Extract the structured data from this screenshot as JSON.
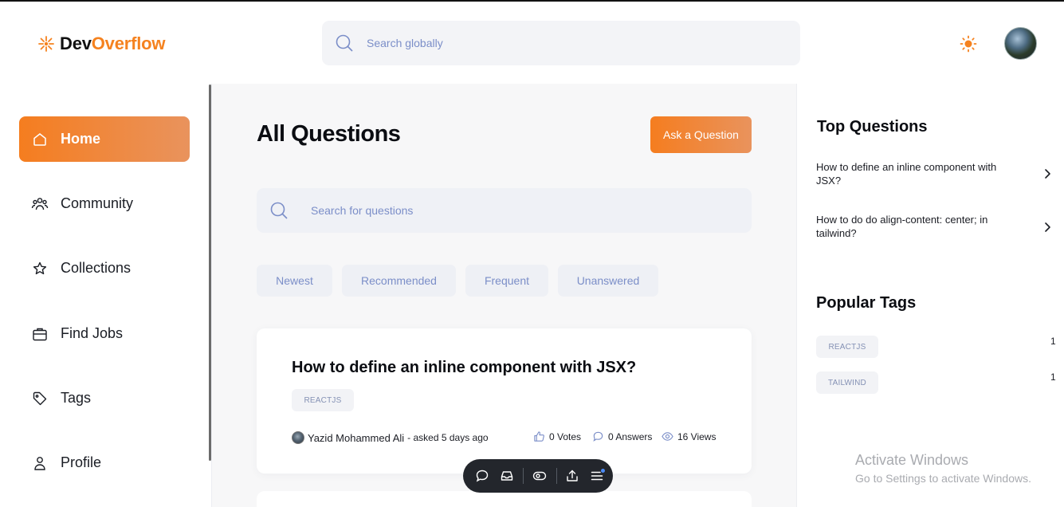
{
  "brand": {
    "name_part1": "Dev",
    "name_part2": "Overflow",
    "accent": "#f5821f"
  },
  "header": {
    "search_placeholder": "Search globally",
    "theme_icon": "sun-icon",
    "avatar_icon": "user-avatar"
  },
  "sidebar": {
    "items": [
      {
        "label": "Home",
        "icon": "home-icon",
        "active": true
      },
      {
        "label": "Community",
        "icon": "users-icon",
        "active": false
      },
      {
        "label": "Collections",
        "icon": "star-icon",
        "active": false
      },
      {
        "label": "Find Jobs",
        "icon": "briefcase-icon",
        "active": false
      },
      {
        "label": "Tags",
        "icon": "tag-icon",
        "active": false
      },
      {
        "label": "Profile",
        "icon": "user-icon",
        "active": false
      }
    ]
  },
  "main": {
    "title": "All Questions",
    "ask_button": "Ask a Question",
    "search_placeholder": "Search for questions",
    "filters": [
      "Newest",
      "Recommended",
      "Frequent",
      "Unanswered"
    ],
    "questions": [
      {
        "title": "How to define an inline component with JSX?",
        "tags": [
          "REACTJS"
        ],
        "author": "Yazid Mohammed Ali",
        "asked": "- asked 5 days ago",
        "votes": "0 Votes",
        "answers": "0 Answers",
        "views": "16 Views"
      }
    ]
  },
  "right": {
    "top_title": "Top Questions",
    "top_questions": [
      "How to define an inline component with JSX?",
      "How to do do align-content: center; in tailwind?"
    ],
    "tags_title": "Popular Tags",
    "popular_tags": [
      {
        "name": "REACTJS",
        "count": "1"
      },
      {
        "name": "TAILWIND",
        "count": "1"
      }
    ]
  },
  "watermark": {
    "line1": "Activate Windows",
    "line2": "Go to Settings to activate Windows."
  },
  "toolbar": {
    "icons": [
      "comment-icon",
      "inbox-icon",
      "eye-toggle-icon",
      "share-icon",
      "menu-icon"
    ]
  }
}
